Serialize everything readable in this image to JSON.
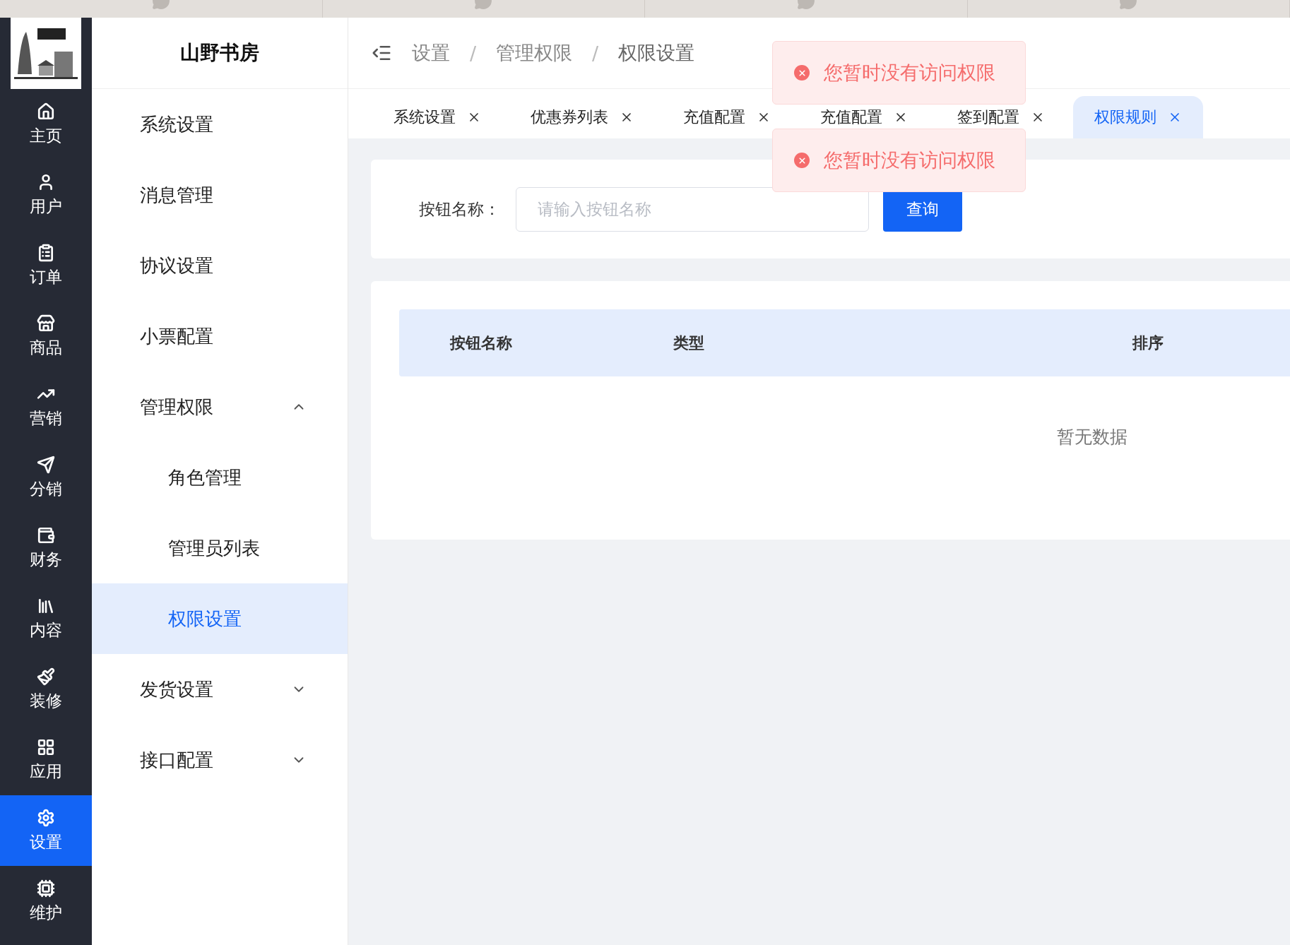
{
  "brand": {
    "name": "山野书房"
  },
  "nav": [
    {
      "label": "主页",
      "selected": false
    },
    {
      "label": "用户",
      "selected": false
    },
    {
      "label": "订单",
      "selected": false
    },
    {
      "label": "商品",
      "selected": false
    },
    {
      "label": "营销",
      "selected": false
    },
    {
      "label": "分销",
      "selected": false
    },
    {
      "label": "财务",
      "selected": false
    },
    {
      "label": "内容",
      "selected": false
    },
    {
      "label": "装修",
      "selected": false
    },
    {
      "label": "应用",
      "selected": false
    },
    {
      "label": "设置",
      "selected": true
    },
    {
      "label": "维护",
      "selected": false
    }
  ],
  "menu": [
    {
      "label": "系统设置",
      "selected": false
    },
    {
      "label": "消息管理",
      "selected": false
    },
    {
      "label": "协议设置",
      "selected": false
    },
    {
      "label": "小票配置",
      "selected": false
    },
    {
      "label": "管理权限",
      "expanded": true,
      "selected": false,
      "children": [
        {
          "label": "角色管理",
          "selected": false
        },
        {
          "label": "管理员列表",
          "selected": false
        },
        {
          "label": "权限设置",
          "selected": true
        }
      ]
    },
    {
      "label": "发货设置",
      "expanded": false,
      "selected": false
    },
    {
      "label": "接口配置",
      "expanded": false,
      "selected": false
    }
  ],
  "breadcrumb": [
    {
      "kind": "link",
      "text": "设置"
    },
    {
      "kind": "separator",
      "text": "/"
    },
    {
      "kind": "link",
      "text": "管理权限"
    },
    {
      "kind": "separator",
      "text": "/"
    },
    {
      "kind": "current",
      "text": "权限设置"
    }
  ],
  "tabs": [
    {
      "label": "系统设置",
      "selected": false
    },
    {
      "label": "优惠券列表",
      "selected": false
    },
    {
      "label": "充值配置",
      "selected": false
    },
    {
      "label": "充值配置",
      "selected": false
    },
    {
      "label": "签到配置",
      "selected": false
    },
    {
      "label": "权限规则",
      "selected": true
    }
  ],
  "toasts": [
    "您暂时没有访问权限",
    "您暂时没有访问权限"
  ],
  "search": {
    "label": "按钮名称：",
    "placeholder": "请输入按钮名称",
    "button": "查询"
  },
  "table": {
    "columns": [
      "按钮名称",
      "类型",
      "排序"
    ],
    "empty": "暂无数据"
  }
}
